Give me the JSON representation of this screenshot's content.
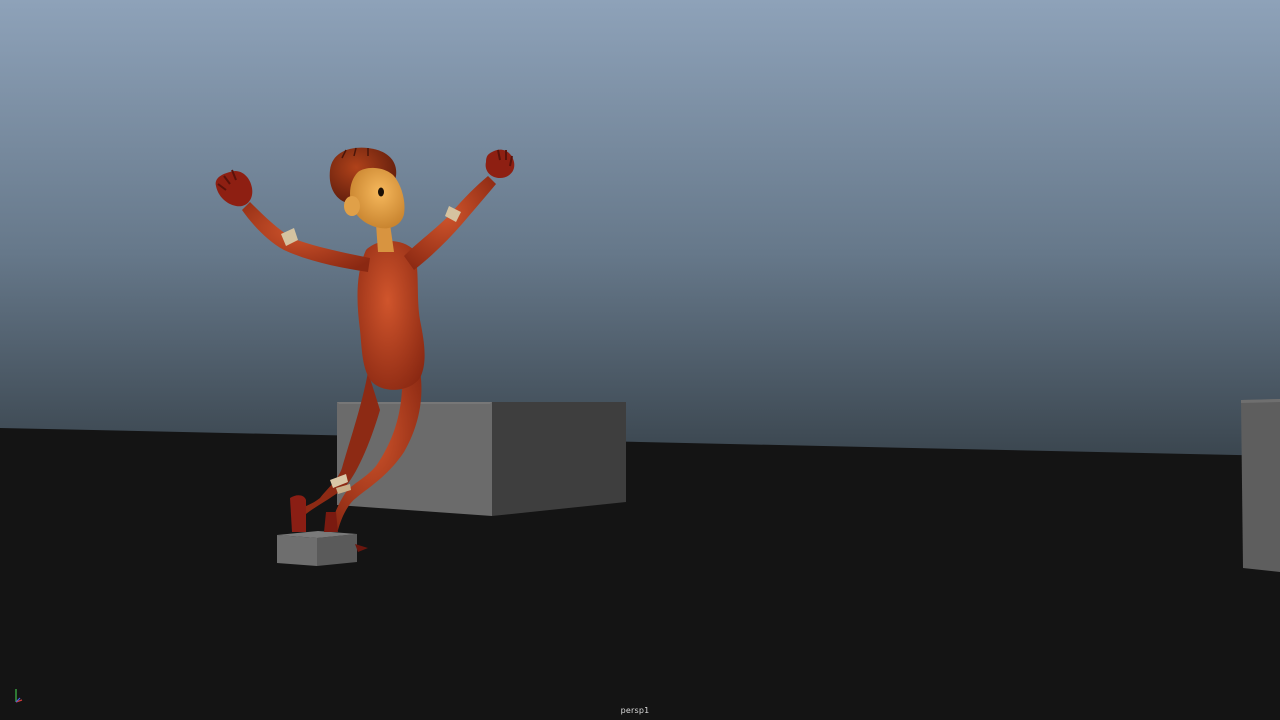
{
  "viewport": {
    "camera_name": "persp1",
    "background_gradient": {
      "top": "#8c9fb6",
      "horizon": "#3f4a53",
      "ground": "#141414"
    }
  },
  "axis_gizmo": {
    "x_color": "#d23a3a",
    "y_color": "#3fbf4a",
    "z_color": "#4a5ee0"
  },
  "character": {
    "suit_color": "#b0391c",
    "skin_color": "#f0a850",
    "hair_color": "#8a2a12"
  },
  "props": {
    "box_light_face": "#6a6a6a",
    "box_dark_face": "#3d3d3d"
  }
}
